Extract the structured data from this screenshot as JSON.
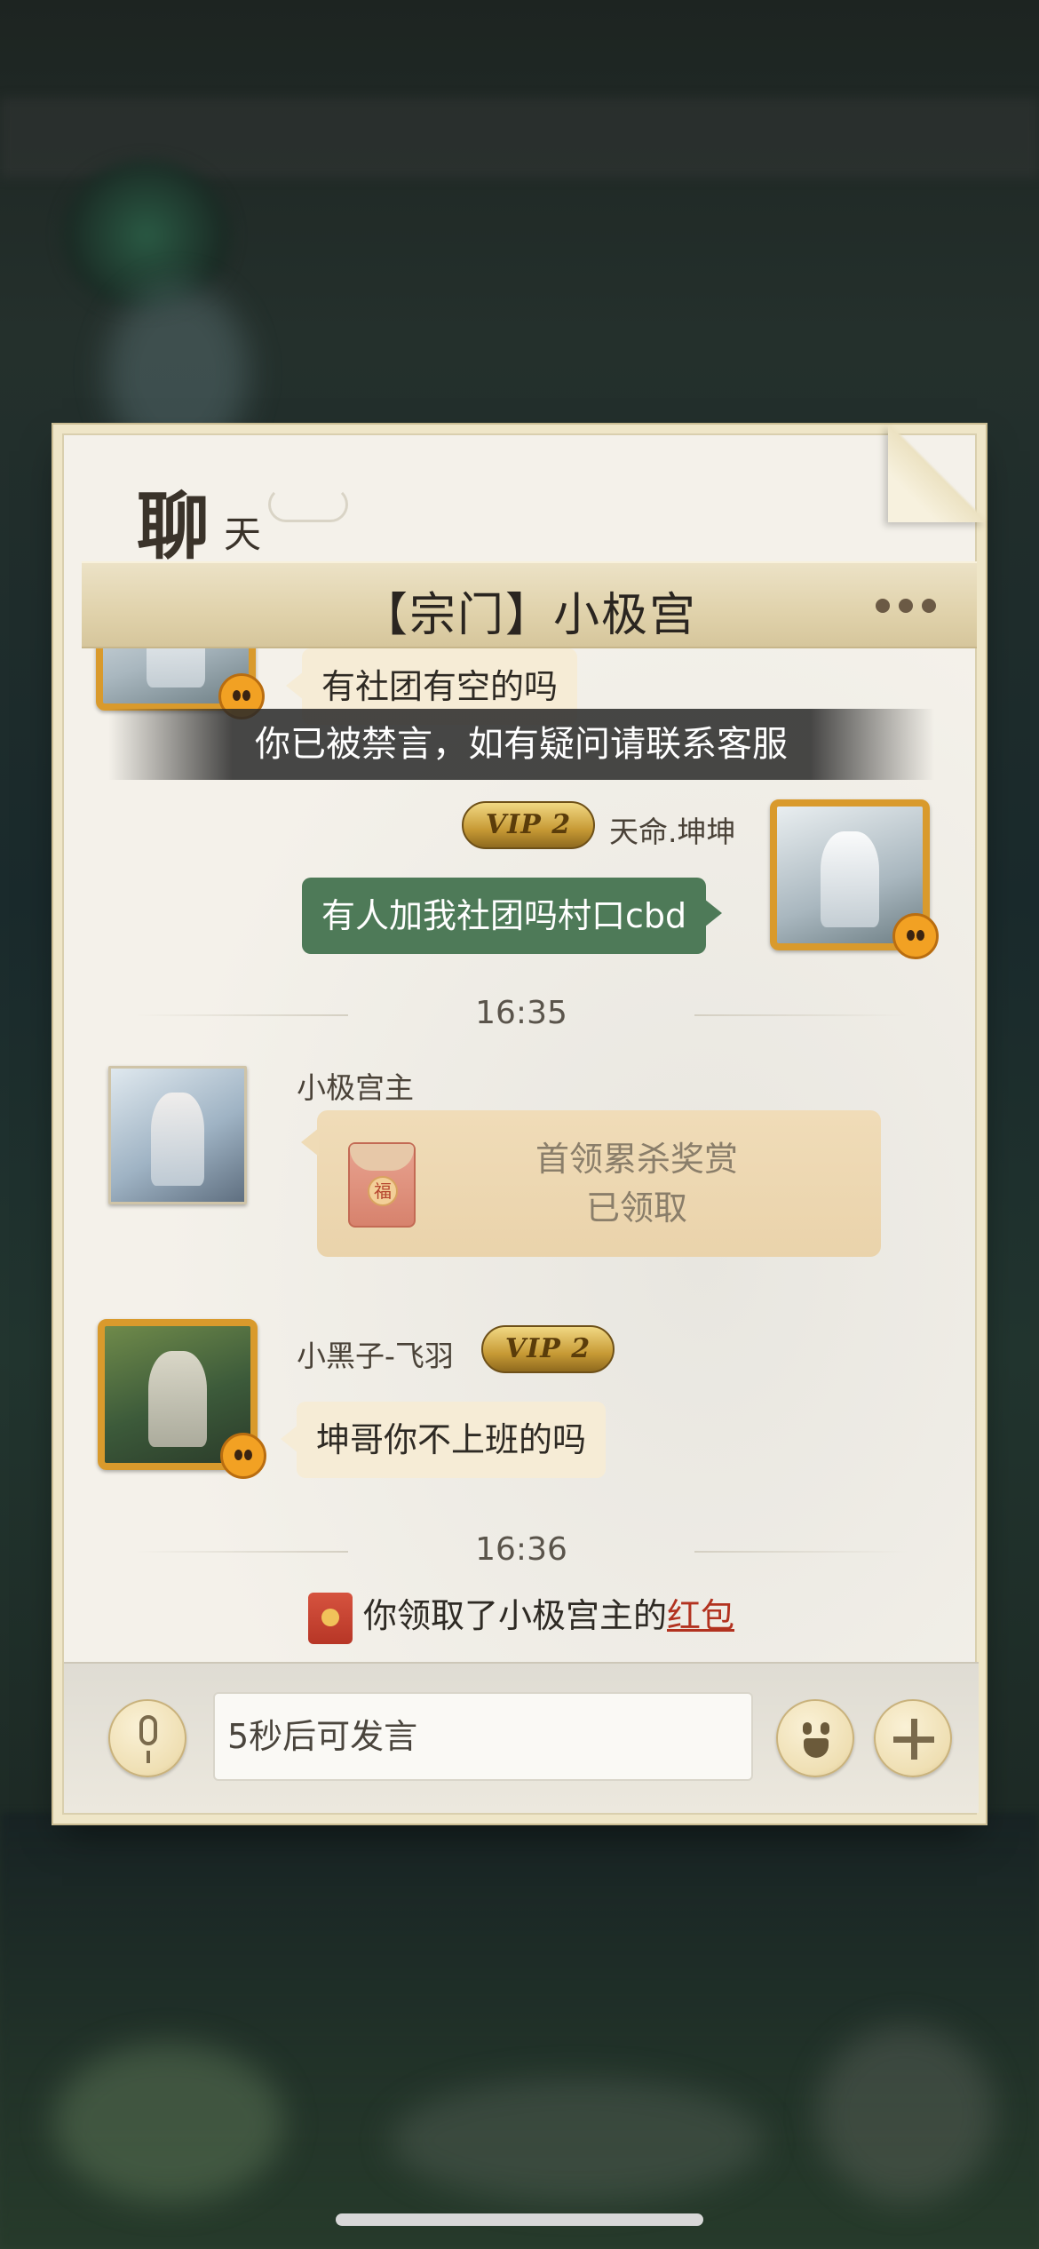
{
  "panel": {
    "title": "聊",
    "title_sub": "天"
  },
  "channel": {
    "title": "【宗门】小极宫"
  },
  "messages": {
    "partial": {
      "text": "有社团有空的吗"
    },
    "ban_notice": "你已被禁言，如有疑问请联系客服",
    "self": {
      "sender": "天命.坤坤",
      "vip": "VIP 2",
      "text": "有人加我社团吗村口cbd"
    },
    "time1": "16:35",
    "red_packet_msg": {
      "sender": "小极宫主",
      "icon_glyph": "福",
      "title": "首领累杀奖赏",
      "status": "已领取"
    },
    "other": {
      "sender": "小黑子-飞羽",
      "vip": "VIP 2",
      "text": "坤哥你不上班的吗"
    },
    "time2": "16:36",
    "system": {
      "text": "你领取了小极宫主的",
      "link": "红包"
    }
  },
  "input": {
    "placeholder": "5秒后可发言"
  },
  "icons": {
    "more": "more-dots-icon",
    "mic": "microphone-icon",
    "emoji": "emoji-face-icon",
    "plus": "plus-icon"
  },
  "colors": {
    "self_bubble": "#4e7a58",
    "other_bubble": "#f6ecd6",
    "red_link": "#b2321f",
    "vip_gold": "#c79a35"
  }
}
